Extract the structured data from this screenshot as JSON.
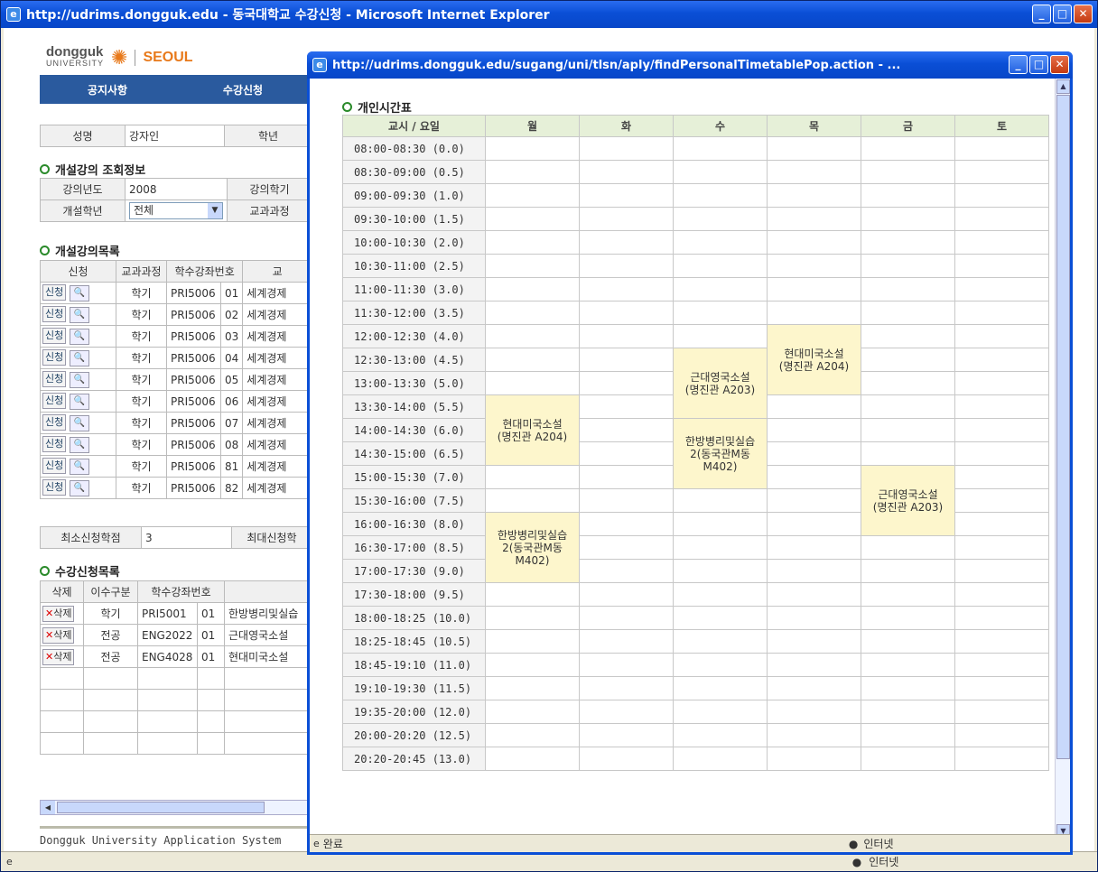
{
  "window": {
    "title": "http://udrims.dongguk.edu - 동국대학교 수강신청 - Microsoft Internet Explorer",
    "status_zone": "인터넷"
  },
  "logo": {
    "name": "dongguk",
    "sub": "UNIVERSITY",
    "campus": "SEOUL"
  },
  "nav": {
    "items": [
      "공지사항",
      "수강신청"
    ]
  },
  "student": {
    "name_label": "성명",
    "name_value": "강자인",
    "year_label": "학년"
  },
  "lookup": {
    "title": "개설강의 조회정보",
    "year_label": "강의년도",
    "year_value": "2008",
    "term_label": "강의학기",
    "grade_label": "개설학년",
    "grade_value": "전체",
    "curr_label": "교과과정"
  },
  "courses": {
    "title": "개설강의목록",
    "headers": [
      "신청",
      "교과과정",
      "학수강좌번호",
      "교"
    ],
    "apply_label": "신청",
    "rows": [
      {
        "type": "학기",
        "code": "PRI5006",
        "sec": "01",
        "name": "세계경제"
      },
      {
        "type": "학기",
        "code": "PRI5006",
        "sec": "02",
        "name": "세계경제"
      },
      {
        "type": "학기",
        "code": "PRI5006",
        "sec": "03",
        "name": "세계경제"
      },
      {
        "type": "학기",
        "code": "PRI5006",
        "sec": "04",
        "name": "세계경제"
      },
      {
        "type": "학기",
        "code": "PRI5006",
        "sec": "05",
        "name": "세계경제"
      },
      {
        "type": "학기",
        "code": "PRI5006",
        "sec": "06",
        "name": "세계경제"
      },
      {
        "type": "학기",
        "code": "PRI5006",
        "sec": "07",
        "name": "세계경제"
      },
      {
        "type": "학기",
        "code": "PRI5006",
        "sec": "08",
        "name": "세계경제"
      },
      {
        "type": "학기",
        "code": "PRI5006",
        "sec": "81",
        "name": "세계경제"
      },
      {
        "type": "학기",
        "code": "PRI5006",
        "sec": "82",
        "name": "세계경제"
      }
    ]
  },
  "credits": {
    "min_label": "최소신청학점",
    "min_value": "3",
    "max_label": "최대신청학"
  },
  "registered": {
    "title": "수강신청목록",
    "headers": [
      "삭제",
      "이수구분",
      "학수강좌번호"
    ],
    "delete_label": "삭제",
    "rows": [
      {
        "type": "학기",
        "code": "PRI5001",
        "sec": "01",
        "name": "한방병리및실습"
      },
      {
        "type": "전공",
        "code": "ENG2022",
        "sec": "01",
        "name": "근대영국소설"
      },
      {
        "type": "전공",
        "code": "ENG4028",
        "sec": "01",
        "name": "현대미국소설"
      }
    ]
  },
  "footer": "Dongguk University Application System",
  "popup": {
    "title": "http://udrims.dongguk.edu/sugang/uni/tlsn/aply/findPersonalTimetablePop.action - ...",
    "heading": "개인시간표",
    "status": "완료",
    "zone": "인터넷",
    "corner_header": "교시 / 요일",
    "days": [
      "월",
      "화",
      "수",
      "목",
      "금",
      "토"
    ],
    "periods": [
      "08:00-08:30 (0.0)",
      "08:30-09:00 (0.5)",
      "09:00-09:30 (1.0)",
      "09:30-10:00 (1.5)",
      "10:00-10:30 (2.0)",
      "10:30-11:00 (2.5)",
      "11:00-11:30 (3.0)",
      "11:30-12:00 (3.5)",
      "12:00-12:30 (4.0)",
      "12:30-13:00 (4.5)",
      "13:00-13:30 (5.0)",
      "13:30-14:00 (5.5)",
      "14:00-14:30 (6.0)",
      "14:30-15:00 (6.5)",
      "15:00-15:30 (7.0)",
      "15:30-16:00 (7.5)",
      "16:00-16:30 (8.0)",
      "16:30-17:00 (8.5)",
      "17:00-17:30 (9.0)",
      "17:30-18:00 (9.5)",
      "18:00-18:25 (10.0)",
      "18:25-18:45 (10.5)",
      "18:45-19:10 (11.0)",
      "19:10-19:30 (11.5)",
      "19:35-20:00 (12.0)",
      "20:00-20:20 (12.5)",
      "20:20-20:45 (13.0)"
    ],
    "classes": [
      {
        "day": 0,
        "start": 11,
        "span": 3,
        "text": "현대미국소설\n(명진관 A204)"
      },
      {
        "day": 0,
        "start": 16,
        "span": 3,
        "text": "한방병리및실습\n2(동국관M동\nM402)"
      },
      {
        "day": 2,
        "start": 9,
        "span": 3,
        "text": "근대영국소설\n(명진관 A203)"
      },
      {
        "day": 2,
        "start": 12,
        "span": 3,
        "text": "한방병리및실습\n2(동국관M동\nM402)"
      },
      {
        "day": 3,
        "start": 8,
        "span": 3,
        "text": "현대미국소설\n(명진관 A204)"
      },
      {
        "day": 4,
        "start": 14,
        "span": 3,
        "text": "근대영국소설\n(명진관 A203)"
      }
    ]
  }
}
